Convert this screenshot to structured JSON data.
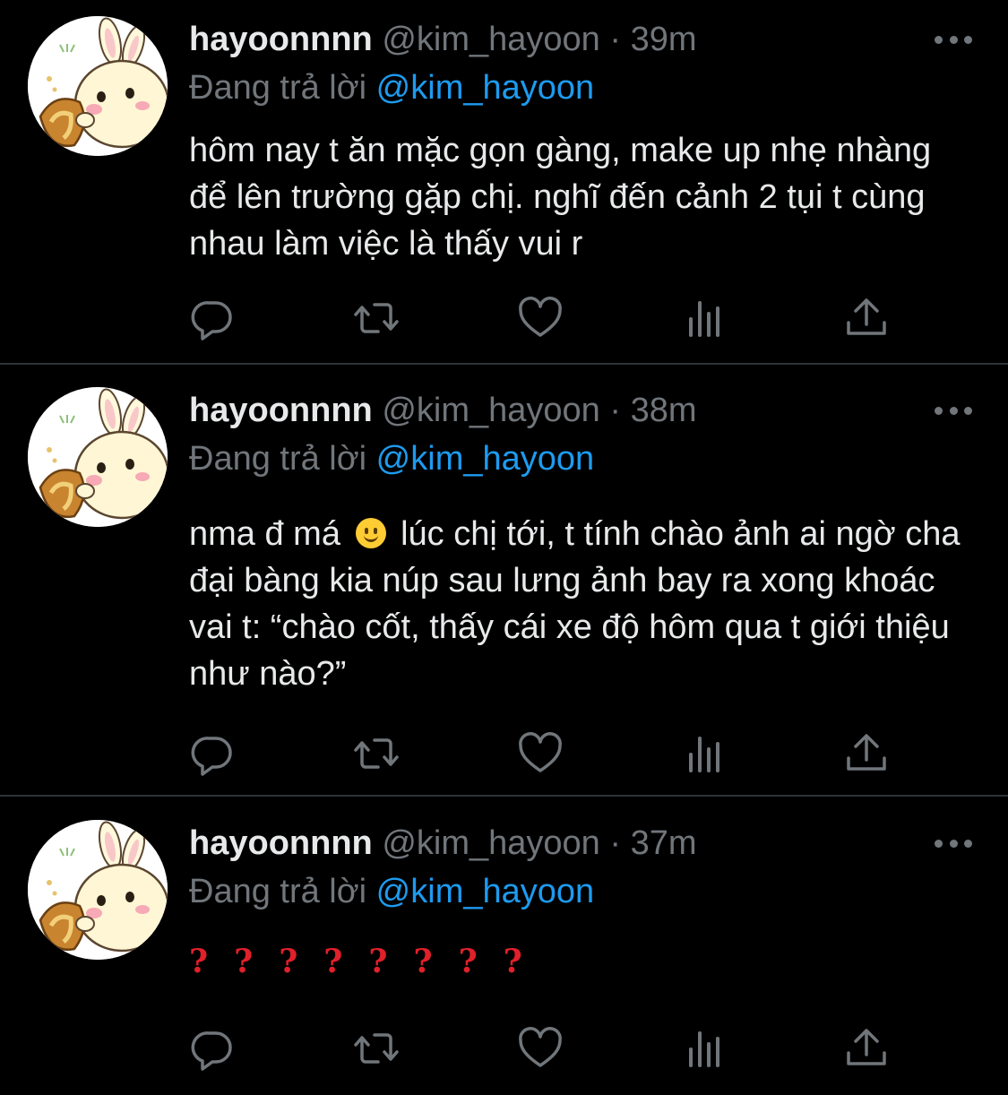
{
  "tweets": [
    {
      "display_name": "hayoonnnn",
      "handle": "@kim_hayoon",
      "separator": "·",
      "time": "39m",
      "reply_prefix": "Đang trả lời",
      "reply_mention": "@kim_hayoon",
      "text": "hôm nay t ăn mặc gọn gàng, make up nhẹ nhàng để lên trường gặp chị. nghĩ đến cảnh 2 tụi t cùng nhau làm việc là thấy vui r"
    },
    {
      "display_name": "hayoonnnn",
      "handle": "@kim_hayoon",
      "separator": "·",
      "time": "38m",
      "reply_prefix": "Đang trả lời",
      "reply_mention": "@kim_hayoon",
      "text_before_emoji": "nma đ má",
      "emoji": "slightly-smiling-face-emoji",
      "text_after_emoji": " lúc chị tới, t tính chào ảnh ai ngờ cha đại bàng kia núp sau lưng ảnh bay ra xong khoác vai t: “chào cốt, thấy cái xe độ hôm qua t giới thiệu như nào?”"
    },
    {
      "display_name": "hayoonnnn",
      "handle": "@kim_hayoon",
      "separator": "·",
      "time": "37m",
      "reply_prefix": "Đang trả lời",
      "reply_mention": "@kim_hayoon",
      "text": "????????"
    }
  ],
  "action_icons": [
    "reply-icon",
    "retweet-icon",
    "like-icon",
    "analytics-icon",
    "share-icon"
  ],
  "colors": {
    "background": "#000000",
    "primary_text": "#e7e9ea",
    "secondary_text": "#71767b",
    "mention": "#1d9bf0",
    "question_marks": "#e0202a",
    "divider": "#2f3336"
  }
}
